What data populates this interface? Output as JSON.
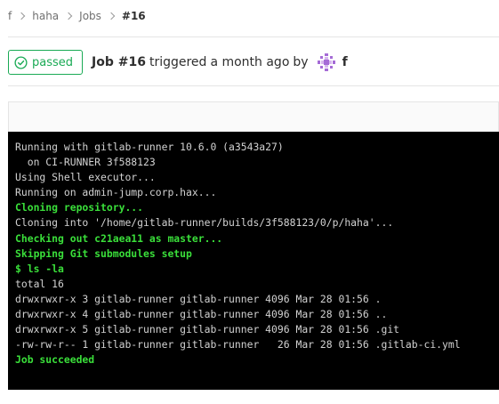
{
  "breadcrumb": {
    "items": [
      {
        "label": "f"
      },
      {
        "label": "haha"
      },
      {
        "label": "Jobs"
      },
      {
        "label": "#16"
      }
    ]
  },
  "header": {
    "status": "passed",
    "job_id": "Job #16",
    "triggered_text": "triggered",
    "time_ago": "a month ago",
    "by_text": "by",
    "user": "f"
  },
  "log": {
    "lines": [
      {
        "text": "Running with gitlab-runner 10.6.0 (a3543a27)",
        "style": "normal"
      },
      {
        "text": "  on CI-RUNNER 3f588123",
        "style": "normal"
      },
      {
        "text": "Using Shell executor...",
        "style": "normal"
      },
      {
        "text": "Running on admin-jump.corp.hax...",
        "style": "normal"
      },
      {
        "text": "Cloning repository...",
        "style": "green"
      },
      {
        "text": "Cloning into '/home/gitlab-runner/builds/3f588123/0/p/haha'...",
        "style": "normal"
      },
      {
        "text": "Checking out c21aea11 as master...",
        "style": "green"
      },
      {
        "text": "Skipping Git submodules setup",
        "style": "green"
      },
      {
        "text": "$ ls -la",
        "style": "green"
      },
      {
        "text": "total 16",
        "style": "normal"
      },
      {
        "text": "drwxrwxr-x 3 gitlab-runner gitlab-runner 4096 Mar 28 01:56 .",
        "style": "normal"
      },
      {
        "text": "drwxrwxr-x 4 gitlab-runner gitlab-runner 4096 Mar 28 01:56 ..",
        "style": "normal"
      },
      {
        "text": "drwxrwxr-x 5 gitlab-runner gitlab-runner 4096 Mar 28 01:56 .git",
        "style": "normal"
      },
      {
        "text": "-rw-rw-r-- 1 gitlab-runner gitlab-runner   26 Mar 28 01:56 .gitlab-ci.yml",
        "style": "normal"
      },
      {
        "text": "Job succeeded",
        "style": "green"
      }
    ]
  },
  "colors": {
    "success": "#1aaa55",
    "log_background": "#000000",
    "log_text": "#d2d2d2",
    "log_green": "#3adf3a"
  },
  "icons": {
    "status": "check-circle-icon",
    "crumb_separator": "chevron-right-icon",
    "avatar": "identicon-avatar"
  }
}
